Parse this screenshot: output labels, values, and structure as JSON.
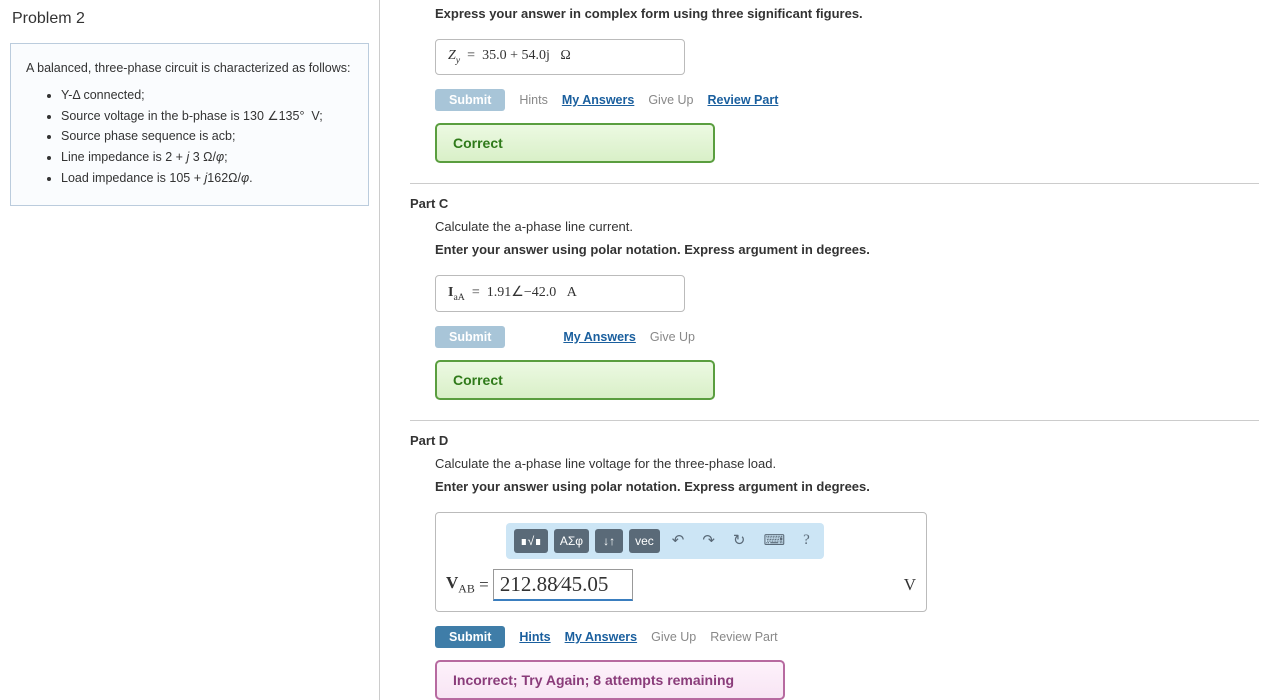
{
  "problem": {
    "title": "Problem 2",
    "intro": "A balanced, three-phase circuit is characterized as follows:",
    "bullets": [
      "Y-Δ connected;",
      "Source voltage in the b-phase is 130 ∠135° V;",
      "Source phase sequence is acb;",
      "Line impedance is 2 + j 3 Ω/φ;",
      "Load impedance is 105 + j162Ω/φ."
    ]
  },
  "partB": {
    "instruction": "Express your answer in complex form using three significant figures.",
    "var": "Z",
    "sub": "y",
    "value": "35.0 + 54.0j",
    "unit": "Ω",
    "buttons": {
      "submit": "Submit",
      "hints": "Hints",
      "my_answers": "My Answers",
      "give_up": "Give Up",
      "review": "Review Part"
    },
    "feedback": "Correct"
  },
  "partC": {
    "title": "Part C",
    "prompt": "Calculate the a-phase line current.",
    "instruction": "Enter your answer using polar notation. Express argument in degrees.",
    "var": "I",
    "sub": "aA",
    "value": "1.91∠−42.0",
    "unit": "A",
    "buttons": {
      "submit": "Submit",
      "my_answers": "My Answers",
      "give_up": "Give Up"
    },
    "feedback": "Correct"
  },
  "partD": {
    "title": "Part D",
    "prompt": "Calculate the a-phase line voltage for the three-phase load.",
    "instruction": "Enter your answer using polar notation. Express argument in degrees.",
    "var": "V",
    "sub": "AB",
    "value": "212.88∕45.05",
    "unit": "V",
    "toolbar": {
      "tpl": "∎√∎",
      "greek": "ΑΣφ",
      "arrows": "↓↑",
      "vec": "vec",
      "undo": "↶",
      "redo": "↷",
      "reset": "↻",
      "kb": "⌨",
      "help": "?"
    },
    "buttons": {
      "submit": "Submit",
      "hints": "Hints",
      "my_answers": "My Answers",
      "give_up": "Give Up",
      "review": "Review Part"
    },
    "feedback": "Incorrect; Try Again; 8 attempts remaining"
  }
}
